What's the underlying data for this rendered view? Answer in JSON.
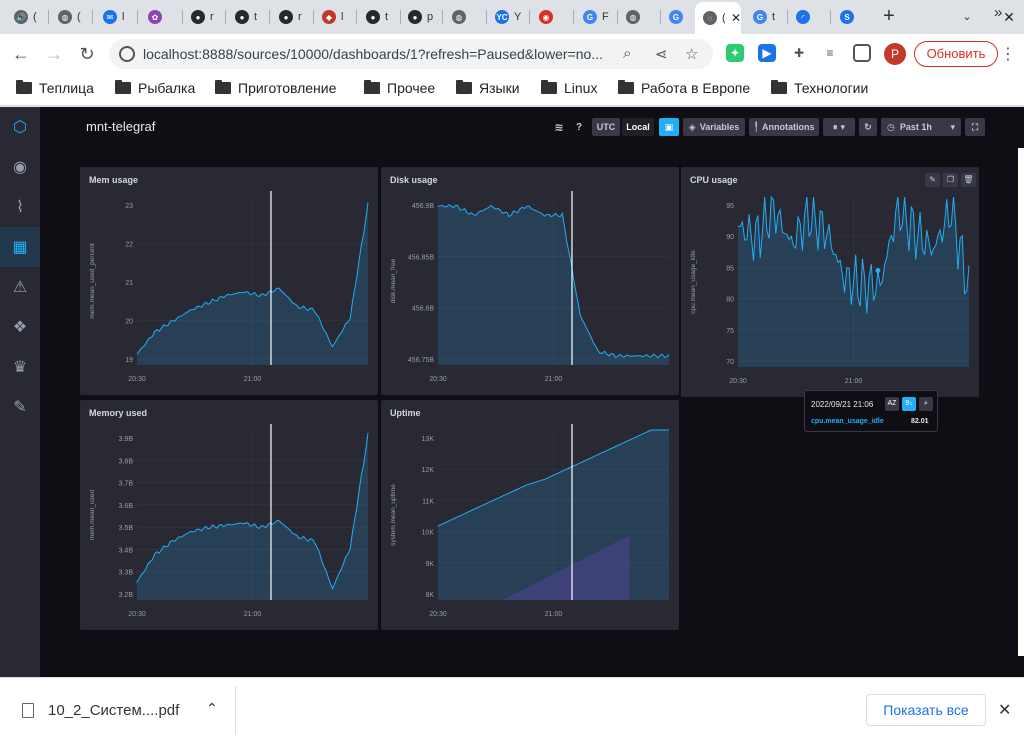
{
  "browser": {
    "tabs": [
      {
        "title": "(",
        "icon": "audio-icon",
        "color": "#5f6368",
        "glyph": "🔊"
      },
      {
        "title": "(",
        "icon": "globe-icon",
        "color": "#5f6368",
        "glyph": "◍"
      },
      {
        "title": "l",
        "icon": "mail-icon",
        "color": "#1a73e8",
        "glyph": "✉"
      },
      {
        "title": "",
        "icon": "colorful-app-icon",
        "color": "#8e44ad",
        "glyph": "✿"
      },
      {
        "title": "r",
        "icon": "github-icon",
        "color": "#24292f",
        "glyph": "●"
      },
      {
        "title": "t",
        "icon": "github-icon",
        "color": "#24292f",
        "glyph": "●"
      },
      {
        "title": "r",
        "icon": "github-icon",
        "color": "#24292f",
        "glyph": "●"
      },
      {
        "title": "l",
        "icon": "red-app-icon",
        "color": "#c0392b",
        "glyph": "◆"
      },
      {
        "title": "t",
        "icon": "github-icon",
        "color": "#24292f",
        "glyph": "●"
      },
      {
        "title": "p",
        "icon": "github-icon",
        "color": "#24292f",
        "glyph": "●"
      },
      {
        "title": "",
        "icon": "globe-icon",
        "color": "#5f6368",
        "glyph": "◍"
      },
      {
        "title": "Y",
        "icon": "yc-icon",
        "color": "#1a73e8",
        "glyph": "YC"
      },
      {
        "title": "",
        "icon": "chrome-icon",
        "color": "#d93025",
        "glyph": "◉"
      },
      {
        "title": "F",
        "icon": "google-icon",
        "color": "#4285f4",
        "glyph": "G"
      },
      {
        "title": "",
        "icon": "globe-icon",
        "color": "#5f6368",
        "glyph": "◍"
      },
      {
        "title": "",
        "icon": "translate-icon",
        "color": "#4285f4",
        "glyph": "G"
      },
      {
        "title": "(",
        "icon": "chronograf-icon",
        "color": "#5f6368",
        "glyph": "◌",
        "active": true
      },
      {
        "title": "t",
        "icon": "google-icon",
        "color": "#4285f4",
        "glyph": "G"
      },
      {
        "title": "",
        "icon": "loading-icon",
        "color": "#1a73e8",
        "glyph": "◜"
      },
      {
        "title": "",
        "icon": "s-app-icon",
        "color": "#1a73e8",
        "glyph": "S"
      }
    ],
    "url": "localhost:8888/sources/10000/dashboards/1?refresh=Paused&lower=no...",
    "update_label": "Обновить",
    "avatar_letter": "P",
    "bookmarks": [
      "Теплица",
      "Рыбалка",
      "Приготовление",
      "Прочее",
      "Языки",
      "Linux",
      "Работа в Европе",
      "Технологии"
    ]
  },
  "dashboard": {
    "name": "mnt-telegraf",
    "tz_utc": "UTC",
    "tz_local": "Local",
    "variables_label": "Variables",
    "annotations_label": "Annotations",
    "pause_label": "⏸",
    "time_range_label": "Past 1h",
    "accent": "#22adf6"
  },
  "cells": {
    "mem_usage": {
      "title": "Mem usage",
      "ylabel": "mem.mean_used_percent",
      "yticks": [
        "23",
        "22",
        "21",
        "20",
        "19"
      ],
      "xticks": [
        "20:30",
        "21:00"
      ]
    },
    "disk_usage": {
      "title": "Disk usage",
      "ylabel": "disk.mean_free",
      "yticks": [
        "456.9B",
        "456.85B",
        "456.8B",
        "456.75B"
      ],
      "xticks": [
        "20:30",
        "21:00"
      ]
    },
    "cpu_usage": {
      "title": "CPU usage",
      "ylabel": "cpu.mean_usage_idle",
      "yticks": [
        "95",
        "90",
        "85",
        "80",
        "75",
        "70"
      ],
      "xticks": [
        "20:30",
        "21:00"
      ]
    },
    "memory_used": {
      "title": "Memory used",
      "ylabel": "mem.mean_used",
      "yticks": [
        "3.9B",
        "3.8B",
        "3.7B",
        "3.6B",
        "3.5B",
        "3.4B",
        "3.3B",
        "3.2B"
      ],
      "xticks": [
        "20:30",
        "21:00"
      ]
    },
    "uptime": {
      "title": "Uptime",
      "ylabel": "system.mean_uptime",
      "yticks": [
        "13K",
        "12K",
        "11K",
        "10K",
        "9K",
        "8K"
      ],
      "xticks": [
        "20:30",
        "21:00"
      ]
    }
  },
  "tooltip": {
    "time": "2022/09/21 21:06",
    "series": "cpu.mean_usage_idle",
    "value": "82.01",
    "sort_label": "AZ",
    "sort_num_label": "9↓",
    "search_icon": "search-icon"
  },
  "downloads": {
    "file_name": "10_2_Систем....pdf",
    "show_all": "Показать все"
  },
  "chart_data": [
    {
      "type": "area",
      "title": "Mem usage",
      "ylabel": "mem.mean_used_percent",
      "x": [
        "20:25",
        "20:30",
        "20:35",
        "20:40",
        "20:45",
        "20:50",
        "20:55",
        "21:00",
        "21:05",
        "21:10",
        "21:15",
        "21:20",
        "21:25",
        "21:30"
      ],
      "values": [
        19.2,
        19.8,
        20.1,
        20.4,
        20.6,
        20.8,
        20.9,
        20.8,
        21.0,
        20.5,
        20.4,
        19.4,
        20.2,
        23.3
      ],
      "ylim": [
        18.9,
        23.5
      ],
      "color": "#22adf6"
    },
    {
      "type": "area",
      "title": "Disk usage",
      "ylabel": "disk.mean_free",
      "x": [
        "20:25",
        "20:30",
        "20:35",
        "20:40",
        "20:45",
        "20:50",
        "20:55",
        "21:00",
        "21:05",
        "21:10",
        "21:15",
        "21:20",
        "21:25",
        "21:30"
      ],
      "values": [
        456.92,
        456.92,
        456.91,
        456.92,
        456.91,
        456.92,
        456.91,
        456.91,
        456.8,
        456.76,
        456.755,
        456.755,
        456.755,
        456.755
      ],
      "ylim": [
        456.745,
        456.93
      ],
      "color": "#22adf6"
    },
    {
      "type": "area",
      "title": "CPU usage",
      "ylabel": "cpu.mean_usage_idle",
      "x": [
        "20:25",
        "20:30",
        "20:35",
        "20:40",
        "20:45",
        "20:50",
        "20:55",
        "21:00",
        "21:05",
        "21:10",
        "21:15",
        "21:20",
        "21:25",
        "21:30"
      ],
      "values": [
        92,
        90,
        95,
        89,
        94,
        91,
        83,
        82,
        82,
        95,
        91,
        88,
        95,
        81
      ],
      "ylim": [
        68,
        97
      ],
      "color": "#22adf6"
    },
    {
      "type": "area",
      "title": "Memory used",
      "ylabel": "mem.mean_used",
      "x": [
        "20:25",
        "20:30",
        "20:35",
        "20:40",
        "20:45",
        "20:50",
        "20:55",
        "21:00",
        "21:05",
        "21:10",
        "21:15",
        "21:20",
        "21:25",
        "21:30"
      ],
      "values": [
        3.25,
        3.37,
        3.43,
        3.47,
        3.49,
        3.5,
        3.51,
        3.49,
        3.52,
        3.45,
        3.43,
        3.22,
        3.4,
        3.9
      ],
      "ylim": [
        3.17,
        3.92
      ],
      "color": "#22adf6"
    },
    {
      "type": "area",
      "title": "Uptime",
      "ylabel": "system.mean_uptime",
      "x": [
        "20:25",
        "20:30",
        "20:35",
        "20:40",
        "20:45",
        "20:50",
        "20:55",
        "21:00",
        "21:05",
        "21:10",
        "21:15",
        "21:20",
        "21:25",
        "21:30"
      ],
      "values": [
        10300,
        10600,
        10900,
        11200,
        11500,
        11800,
        12000,
        12300,
        12600,
        12900,
        13200,
        13500,
        13800,
        13800
      ],
      "ylim": [
        7600,
        13800
      ],
      "color": "#22adf6",
      "secondary_color": "#7a2ea8"
    }
  ]
}
